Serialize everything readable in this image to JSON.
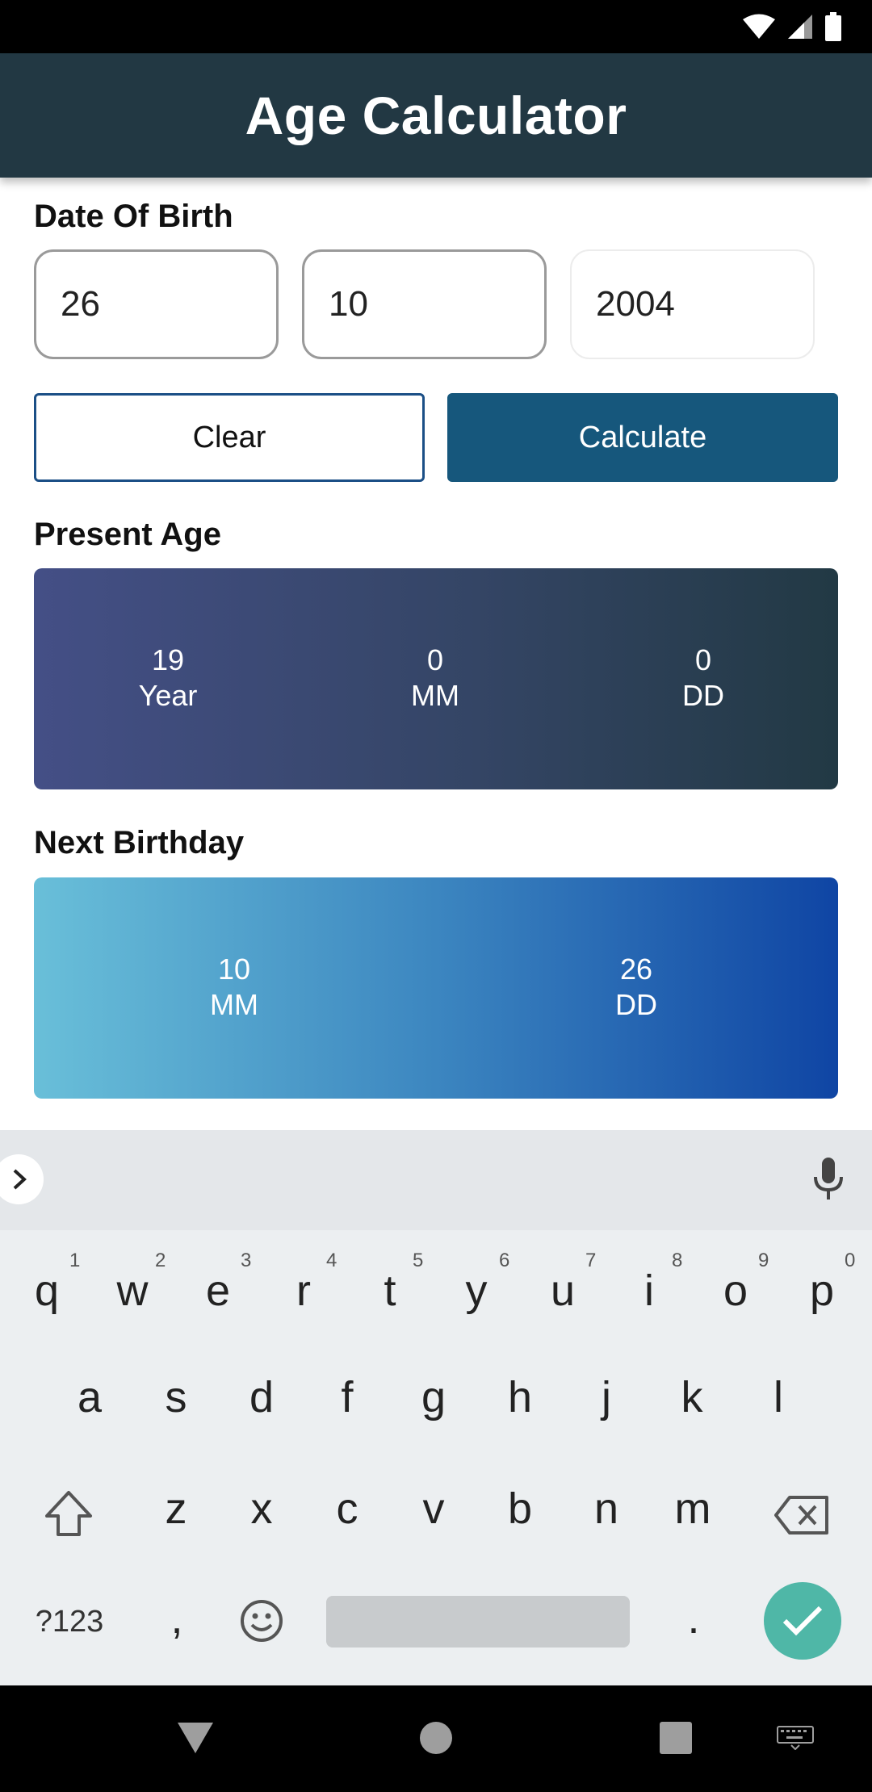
{
  "app": {
    "title": "Age Calculator"
  },
  "dob": {
    "label": "Date Of Birth",
    "day": "26",
    "month": "10",
    "year": "2004"
  },
  "buttons": {
    "clear": "Clear",
    "calculate": "Calculate"
  },
  "present_age": {
    "label": "Present Age",
    "years": {
      "value": "19",
      "unit": "Year"
    },
    "months": {
      "value": "0",
      "unit": "MM"
    },
    "days": {
      "value": "0",
      "unit": "DD"
    }
  },
  "next_birthday": {
    "label": "Next Birthday",
    "months": {
      "value": "10",
      "unit": "MM"
    },
    "days": {
      "value": "26",
      "unit": "DD"
    }
  },
  "keyboard": {
    "row1": [
      {
        "k": "q",
        "n": "1"
      },
      {
        "k": "w",
        "n": "2"
      },
      {
        "k": "e",
        "n": "3"
      },
      {
        "k": "r",
        "n": "4"
      },
      {
        "k": "t",
        "n": "5"
      },
      {
        "k": "y",
        "n": "6"
      },
      {
        "k": "u",
        "n": "7"
      },
      {
        "k": "i",
        "n": "8"
      },
      {
        "k": "o",
        "n": "9"
      },
      {
        "k": "p",
        "n": "0"
      }
    ],
    "row2": [
      "a",
      "s",
      "d",
      "f",
      "g",
      "h",
      "j",
      "k",
      "l"
    ],
    "row3": [
      "z",
      "x",
      "c",
      "v",
      "b",
      "n",
      "m"
    ],
    "symbols": "?123",
    "comma": ",",
    "period": "."
  },
  "icons": {
    "wifi": "wifi-icon",
    "signal": "signal-icon",
    "battery": "battery-icon",
    "expand": "chevron-right-icon",
    "mic": "microphone-icon",
    "shift": "shift-icon",
    "backspace": "backspace-icon",
    "emoji": "emoji-icon",
    "enter": "checkmark-icon",
    "back": "back-triangle-icon",
    "home": "home-circle-icon",
    "recents": "recents-square-icon",
    "keyboard": "keyboard-icon"
  },
  "colors": {
    "app_bar": "#223843",
    "calculate_button": "#16577c",
    "present_gradient": [
      "#444f86",
      "#223944"
    ],
    "next_gradient": [
      "#69bfd9",
      "#0f45a4"
    ],
    "enter_key": "#4fb7a7"
  }
}
